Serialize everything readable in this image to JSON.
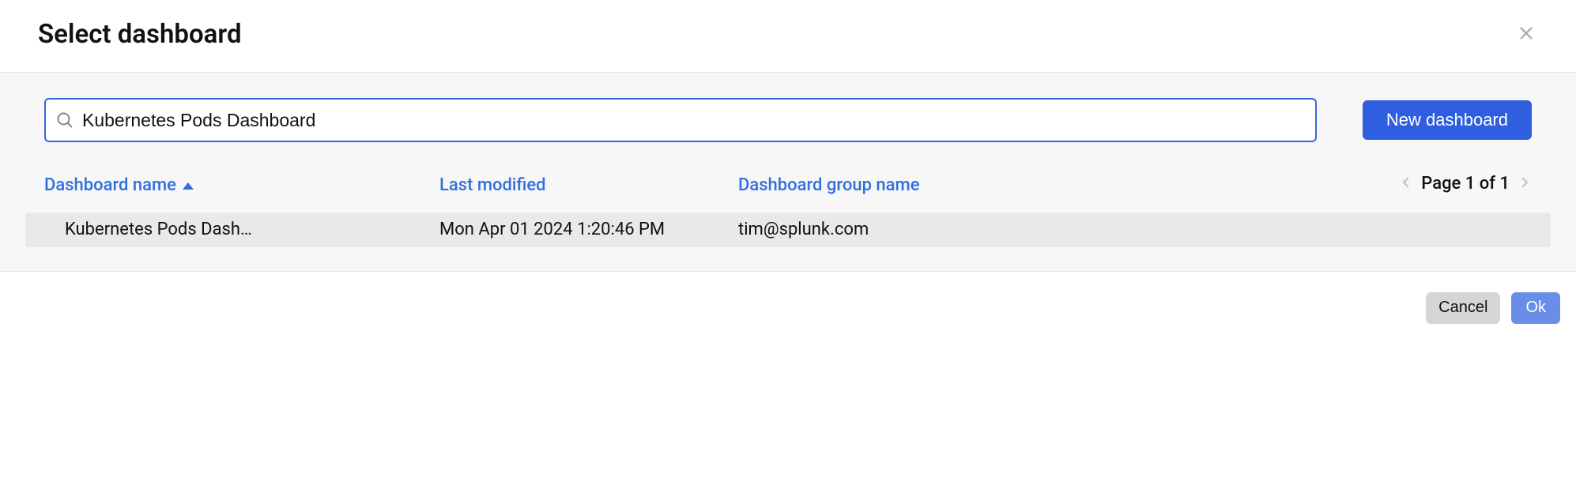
{
  "dialog": {
    "title": "Select dashboard"
  },
  "search": {
    "value": "Kubernetes Pods Dashboard",
    "placeholder": ""
  },
  "toolbar": {
    "new_dashboard_label": "New dashboard"
  },
  "columns": {
    "name": "Dashboard name",
    "modified": "Last modified",
    "group": "Dashboard group name"
  },
  "pager": {
    "text": "Page 1 of 1"
  },
  "rows": [
    {
      "name": "Kubernetes Pods Dash…",
      "modified": "Mon Apr 01 2024 1:20:46 PM",
      "group": "tim@splunk.com"
    }
  ],
  "footer": {
    "cancel_label": "Cancel",
    "ok_label": "Ok"
  }
}
